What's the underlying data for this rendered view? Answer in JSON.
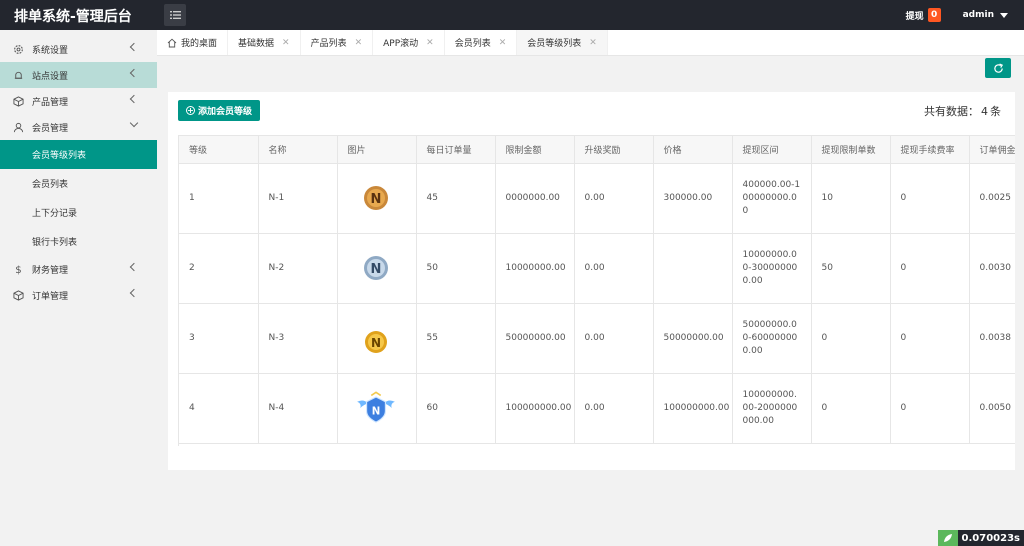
{
  "header": {
    "brand": "排单系统-管理后台",
    "withdraw_label": "提现",
    "withdraw_count": "0",
    "user": "admin"
  },
  "sidebar": {
    "items": [
      {
        "label": "系统设置",
        "icon": "gear-icon"
      },
      {
        "label": "站点设置",
        "icon": "bell-icon"
      },
      {
        "label": "产品管理",
        "icon": "cube-icon"
      },
      {
        "label": "会员管理",
        "icon": "user-icon"
      },
      {
        "label": "财务管理",
        "icon": "dollar-icon"
      },
      {
        "label": "订单管理",
        "icon": "cube-icon"
      }
    ],
    "member_sub": [
      {
        "label": "会员等级列表"
      },
      {
        "label": "会员列表"
      },
      {
        "label": "上下分记录"
      },
      {
        "label": "银行卡列表"
      }
    ]
  },
  "tabs": [
    {
      "label": "我的桌面"
    },
    {
      "label": "基础数据"
    },
    {
      "label": "产品列表"
    },
    {
      "label": "APP滚动"
    },
    {
      "label": "会员列表"
    },
    {
      "label": "会员等级列表"
    }
  ],
  "toolbar": {
    "add_label": "添加会员等级",
    "total_prefix": "共有数据：",
    "total_count": "4",
    "total_unit": "条"
  },
  "table": {
    "columns": [
      "等级",
      "名称",
      "图片",
      "每日订单量",
      "限制金额",
      "升级奖励",
      "价格",
      "提现区间",
      "提现限制单数",
      "提现手续费率",
      "订单佣金"
    ],
    "rows": [
      {
        "level": "1",
        "name": "N-1",
        "daily": "45",
        "limit": "0000000.00",
        "reward": "0.00",
        "price": "300000.00",
        "range": "400000.00-100000000.00",
        "wd_limit": "10",
        "fee": "0",
        "commission": "0.0025"
      },
      {
        "level": "2",
        "name": "N-2",
        "daily": "50",
        "limit": "10000000.00",
        "reward": "0.00",
        "price": "",
        "range": "10000000.00-300000000.00",
        "wd_limit": "50",
        "fee": "0",
        "commission": "0.0030"
      },
      {
        "level": "3",
        "name": "N-3",
        "daily": "55",
        "limit": "50000000.00",
        "reward": "0.00",
        "price": "50000000.00",
        "range": "50000000.00-600000000.00",
        "wd_limit": "0",
        "fee": "0",
        "commission": "0.0038"
      },
      {
        "level": "4",
        "name": "N-4",
        "daily": "60",
        "limit": "100000000.00",
        "reward": "0.00",
        "price": "100000000.00",
        "range": "100000000.00-2000000000.00",
        "wd_limit": "0",
        "fee": "0",
        "commission": "0.0050"
      }
    ]
  },
  "footer": {
    "timer": "0.070023s"
  },
  "colors": {
    "accent": "#009688",
    "header": "#23262e",
    "badge": "#ff5722"
  }
}
